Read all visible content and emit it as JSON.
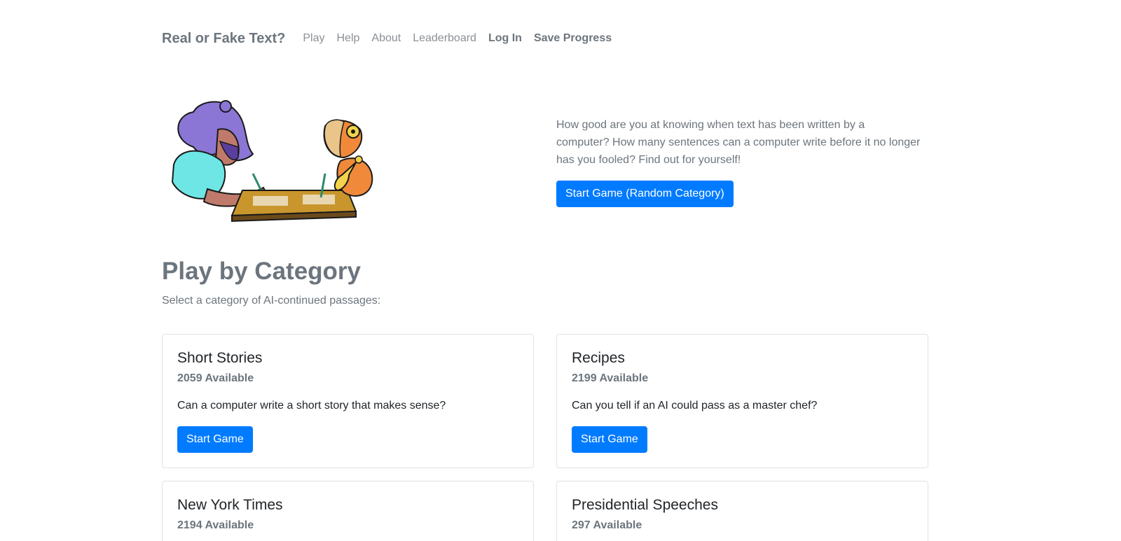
{
  "nav": {
    "brand": "Real or Fake Text?",
    "links": [
      "Play",
      "Help",
      "About",
      "Leaderboard"
    ],
    "login": "Log In",
    "save": "Save Progress"
  },
  "hero": {
    "text": "How good are you at knowing when text has been written by a computer? How many sentences can a computer write before it no longer has you fooled? Find out for yourself!",
    "button": "Start Game (Random Category)"
  },
  "section": {
    "title": "Play by Category",
    "subtitle": "Select a category of AI-continued passages:"
  },
  "categories": [
    {
      "title": "Short Stories",
      "count": "2059 Available",
      "desc": "Can a computer write a short story that makes sense?",
      "button": "Start Game"
    },
    {
      "title": "Recipes",
      "count": "2199 Available",
      "desc": "Can you tell if an AI could pass as a master chef?",
      "button": "Start Game"
    },
    {
      "title": "New York Times",
      "count": "2194 Available",
      "desc": "",
      "button": ""
    },
    {
      "title": "Presidential Speeches",
      "count": "297 Available",
      "desc": "",
      "button": ""
    }
  ],
  "colors": {
    "accent": "#007bff",
    "muted": "#6c757d",
    "text": "#212529"
  }
}
